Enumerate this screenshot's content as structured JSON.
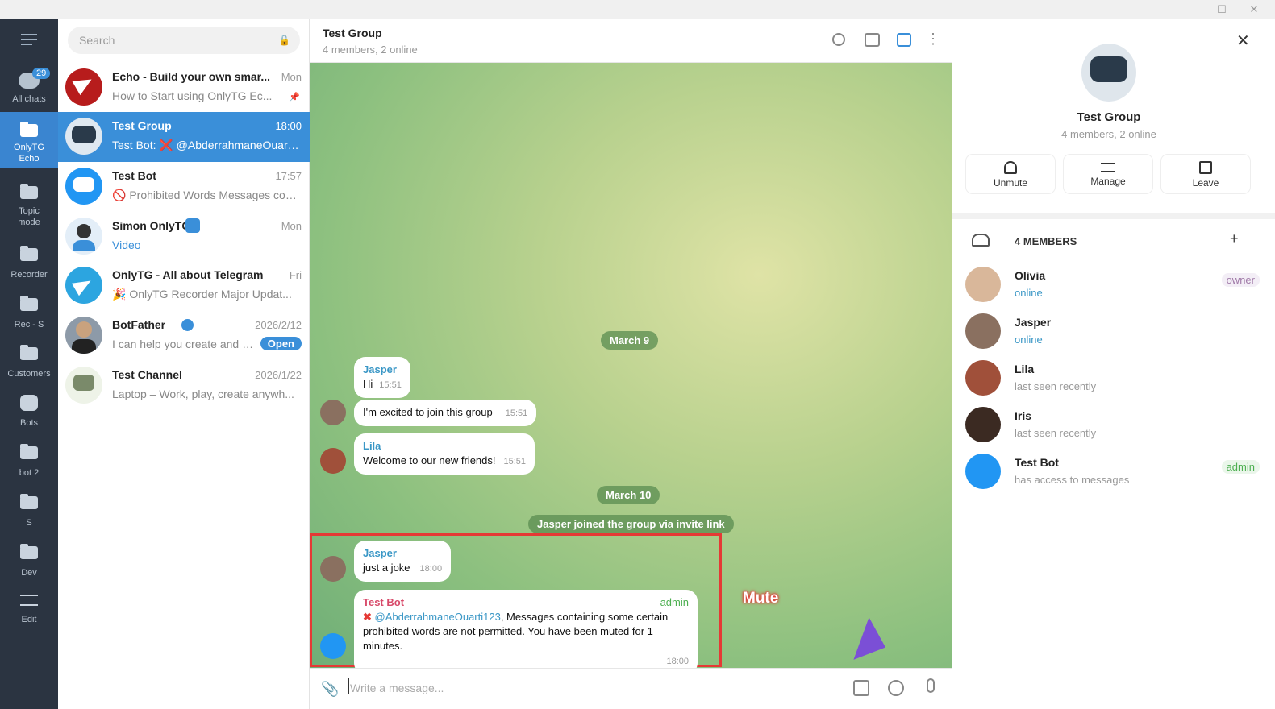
{
  "window": {
    "min": "—",
    "max": "☐",
    "close": "✕"
  },
  "rail": {
    "items": [
      {
        "label": "All chats",
        "badge": "29"
      },
      {
        "label": "OnlyTG Echo"
      },
      {
        "label": "Topic mode"
      },
      {
        "label": "Recorder"
      },
      {
        "label": "Rec - S"
      },
      {
        "label": "Customers"
      },
      {
        "label": "Bots"
      },
      {
        "label": "bot 2"
      },
      {
        "label": "S"
      },
      {
        "label": "Dev"
      },
      {
        "label": "Edit"
      }
    ]
  },
  "list": {
    "search_placeholder": "Search",
    "chats": [
      {
        "name": "Echo - Build your own smar...",
        "time": "Mon",
        "preview": "How to Start using OnlyTG Ec..."
      },
      {
        "name": "Test Group",
        "time": "18:00",
        "preview": "Test Bot: ❌ @AbderrahmaneOuarti1..."
      },
      {
        "name": "Test Bot",
        "time": "17:57",
        "preview": "🚫 Prohibited Words  Messages cont..."
      },
      {
        "name": "Simon OnlyTG",
        "time": "Mon",
        "preview": "Video"
      },
      {
        "name": "OnlyTG - All about Telegram",
        "time": "Fri",
        "preview": "🎉 OnlyTG Recorder Major Updat..."
      },
      {
        "name": "BotFather",
        "time": "2026/2/12",
        "preview": "I can help you create and ma...",
        "action": "Open"
      },
      {
        "name": "Test Channel",
        "time": "2026/1/22",
        "preview": "Laptop – Work, play, create anywh..."
      }
    ]
  },
  "conversation": {
    "title": "Test Group",
    "subtitle": "4 members, 2 online",
    "date1": "March 9",
    "date2": "March 10",
    "service": "Jasper joined the group via invite link",
    "messages": [
      {
        "sender": "Jasper",
        "text": "Hi",
        "time": "15:51"
      },
      {
        "sender": "",
        "text": "I'm excited to join this group",
        "time": "15:51"
      },
      {
        "sender": "Lila",
        "text": "Welcome to our new friends!",
        "time": "15:51"
      },
      {
        "sender": "Jasper",
        "text": "just a joke",
        "time": "18:00"
      },
      {
        "sender": "Test Bot",
        "badge": "admin",
        "mention": "@AbderrahmaneOuarti123",
        "text": ", Messages containing some certain prohibited words are not permitted. You have been muted for 1 minutes.",
        "time": "18:00"
      }
    ],
    "annotation": "Mute",
    "compose_placeholder": "Write a message..."
  },
  "info": {
    "title": "Test Group",
    "subtitle": "4 members, 2 online",
    "actions": [
      "Unmute",
      "Manage",
      "Leave"
    ],
    "members_header": "4 MEMBERS",
    "members": [
      {
        "name": "Olivia",
        "status": "online",
        "role": "owner"
      },
      {
        "name": "Jasper",
        "status": "online",
        "role": ""
      },
      {
        "name": "Lila",
        "status": "last seen recently",
        "role": ""
      },
      {
        "name": "Iris",
        "status": "last seen recently",
        "role": ""
      },
      {
        "name": "Test Bot",
        "status": "has access to messages",
        "role": "admin"
      }
    ]
  },
  "colors": {
    "accent": "#3a8fd9",
    "rail": "#2b3441",
    "highlight": "#e53935",
    "admin": "#4caf50"
  }
}
